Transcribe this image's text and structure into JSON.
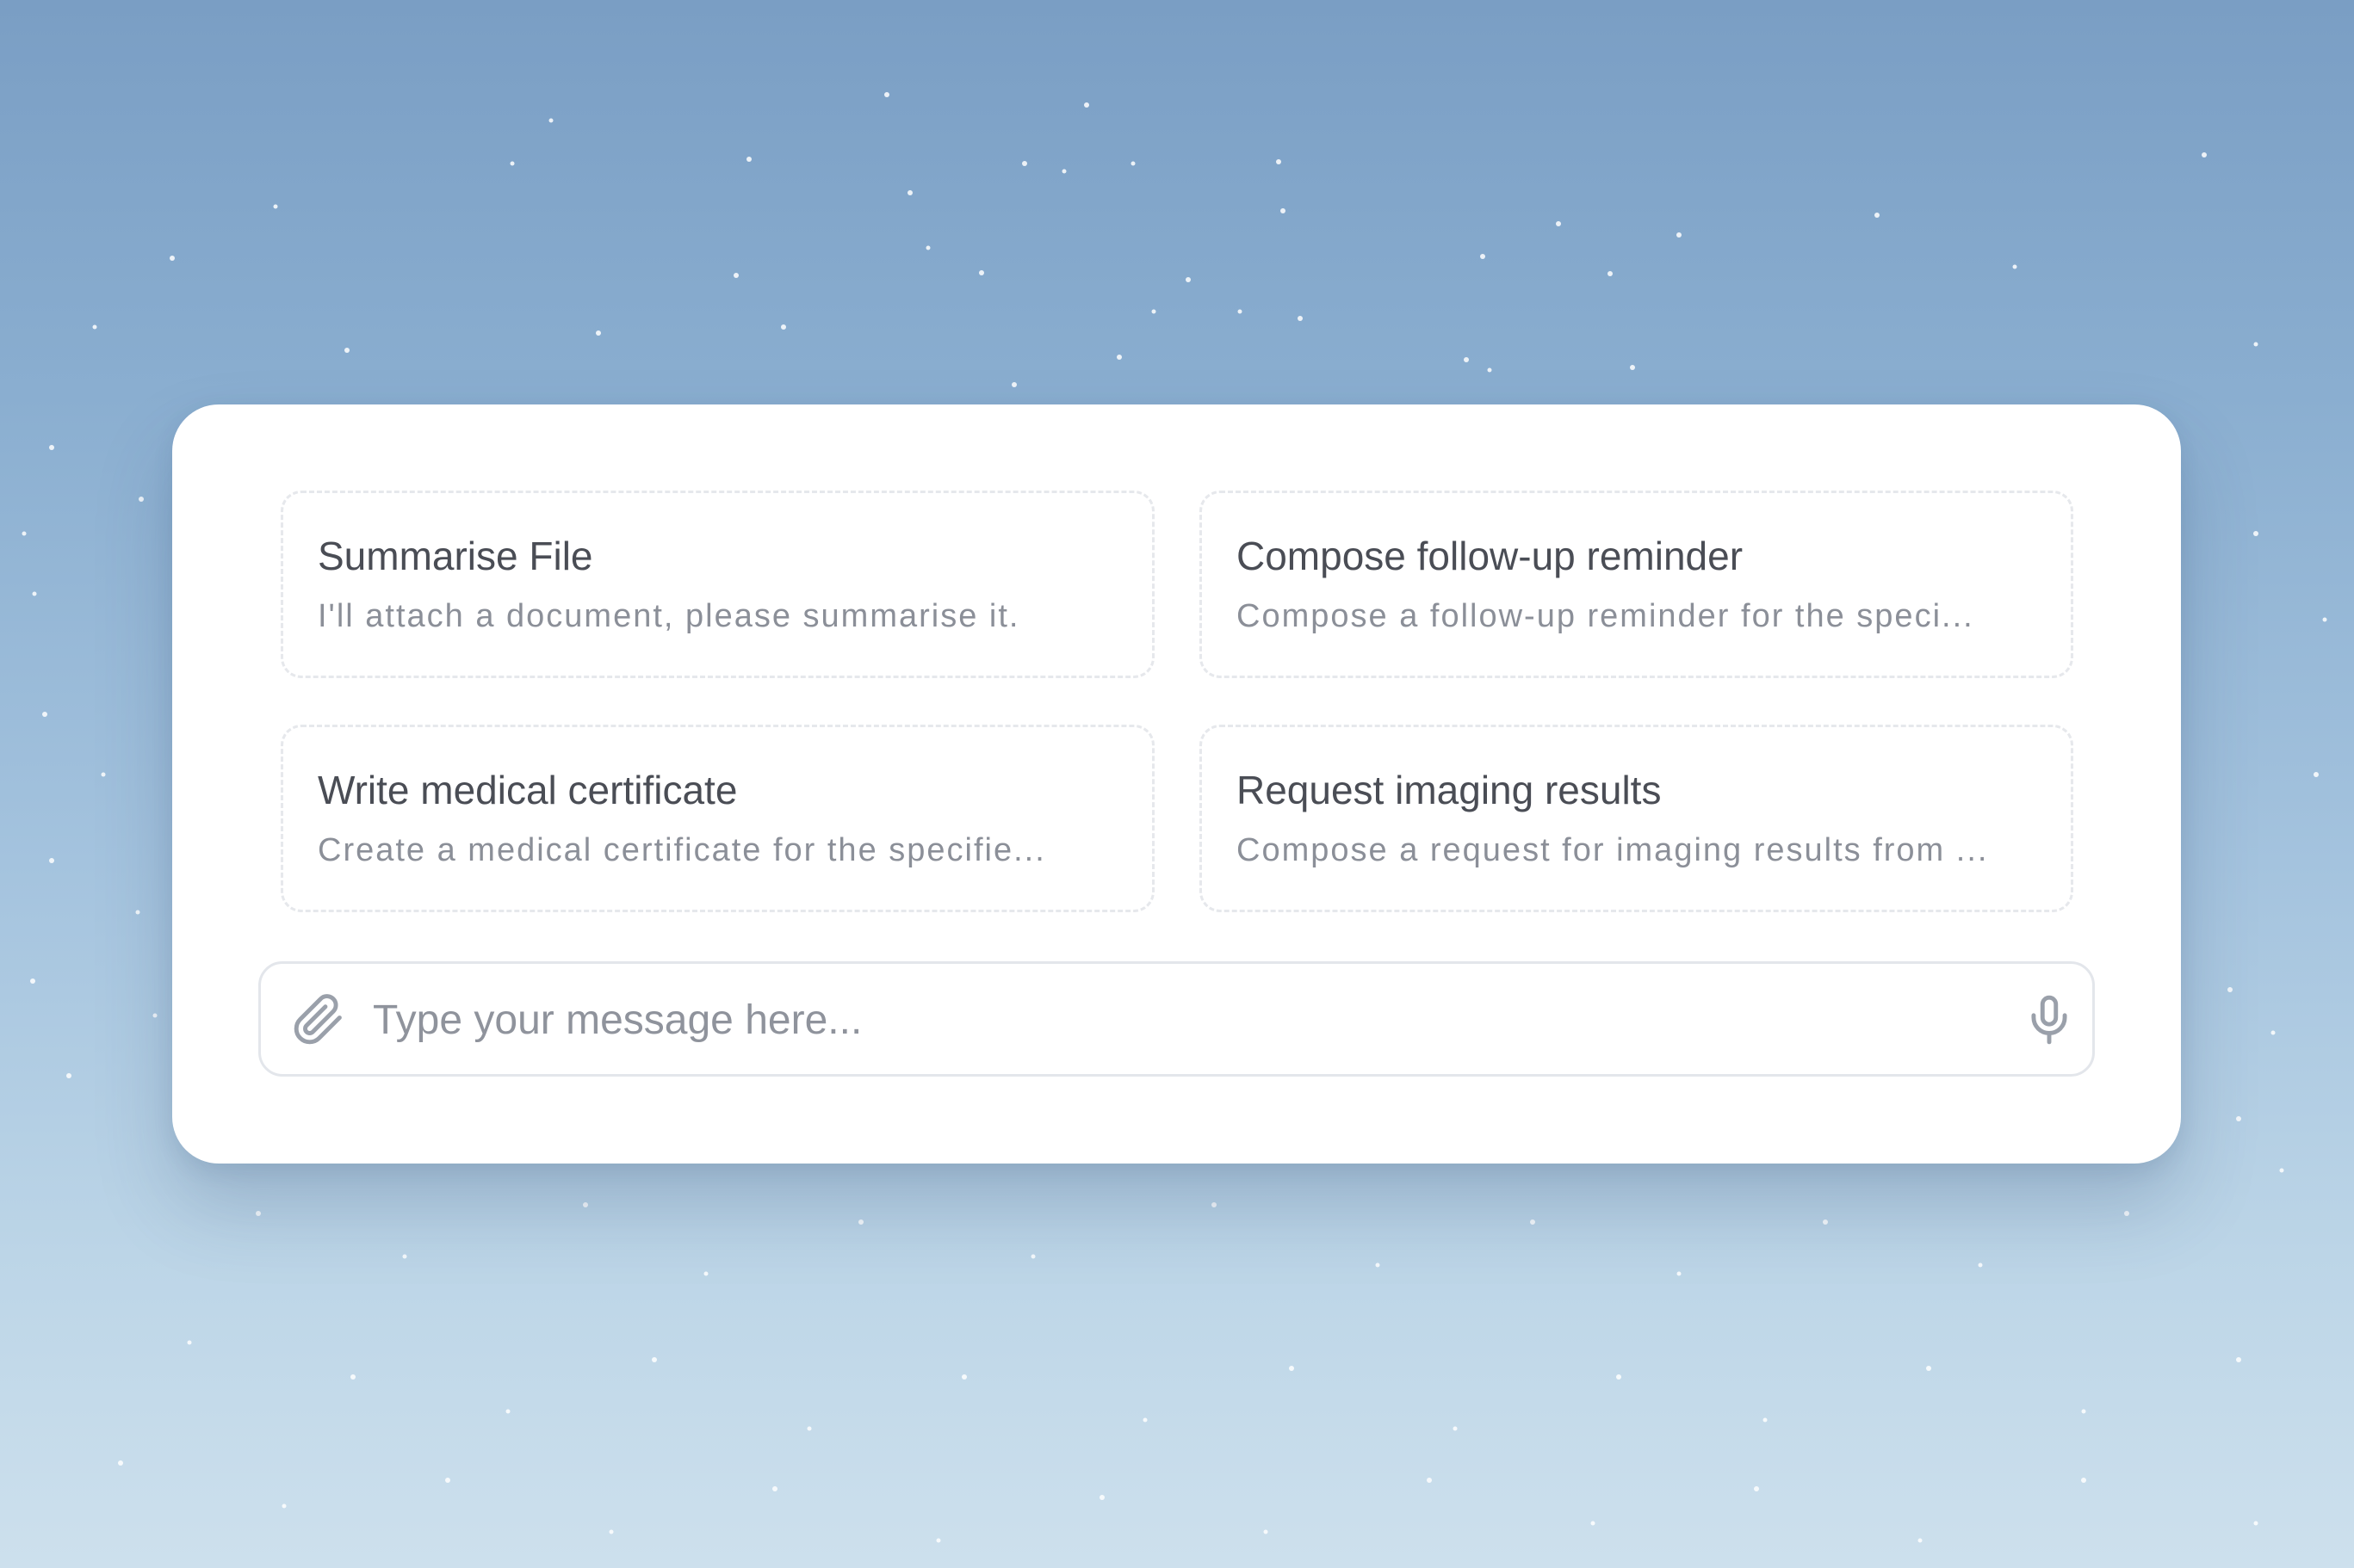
{
  "suggestions": [
    {
      "title": "Summarise File",
      "description": "I'll attach a document, please summarise it."
    },
    {
      "title": "Compose follow-up reminder",
      "description": "Compose a follow-up reminder for the speci..."
    },
    {
      "title": "Write medical certificate",
      "description": "Create a medical certificate for the specifie..."
    },
    {
      "title": "Request imaging results",
      "description": "Compose a request for imaging results from ..."
    }
  ],
  "composer": {
    "placeholder": "Type your message here...",
    "value": "",
    "attach_icon": "paperclip-icon",
    "mic_icon": "microphone-icon"
  },
  "colors": {
    "background_top": "#7a9ec4",
    "background_bottom": "#cde0ed",
    "panel": "#ffffff",
    "title_text": "#4a4d55",
    "description_text": "#8b8f98",
    "icon": "#9aa0aa"
  }
}
